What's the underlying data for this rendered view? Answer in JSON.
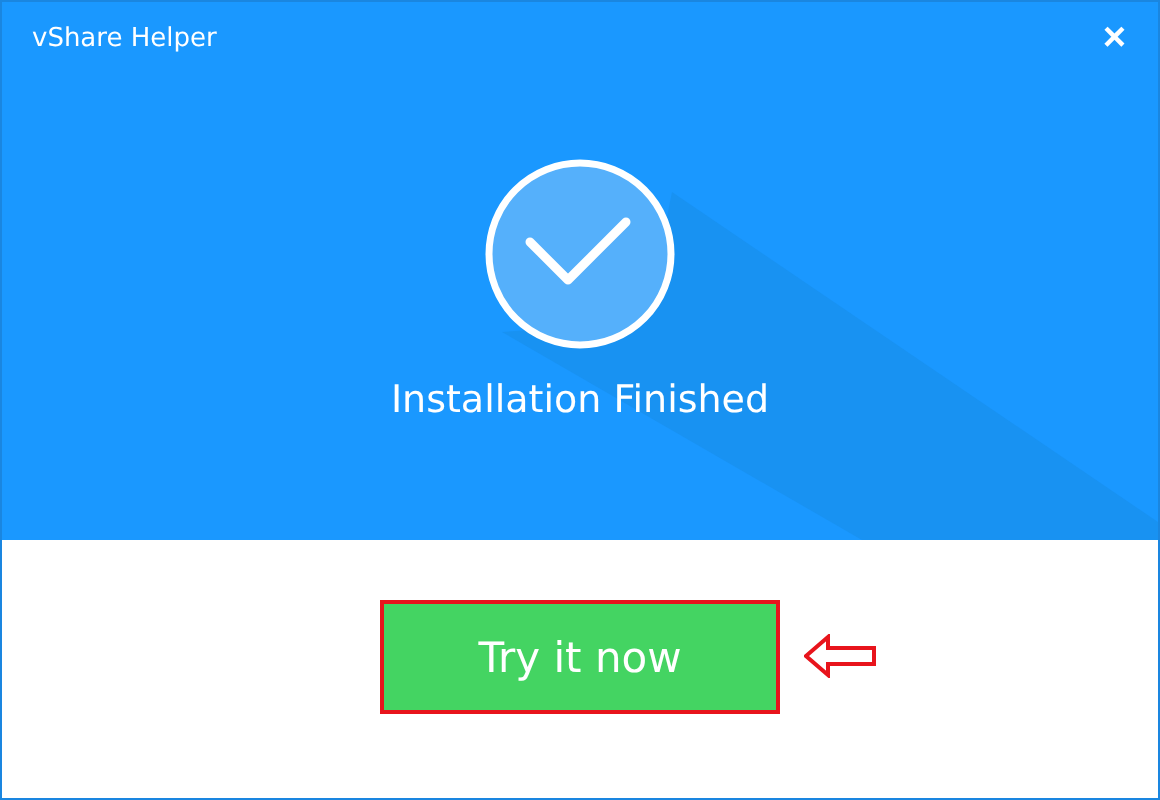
{
  "window": {
    "title": "vShare Helper",
    "close": "×"
  },
  "status": {
    "message": "Installation Finished"
  },
  "action": {
    "label": "Try it now",
    "highlighted": true
  }
}
